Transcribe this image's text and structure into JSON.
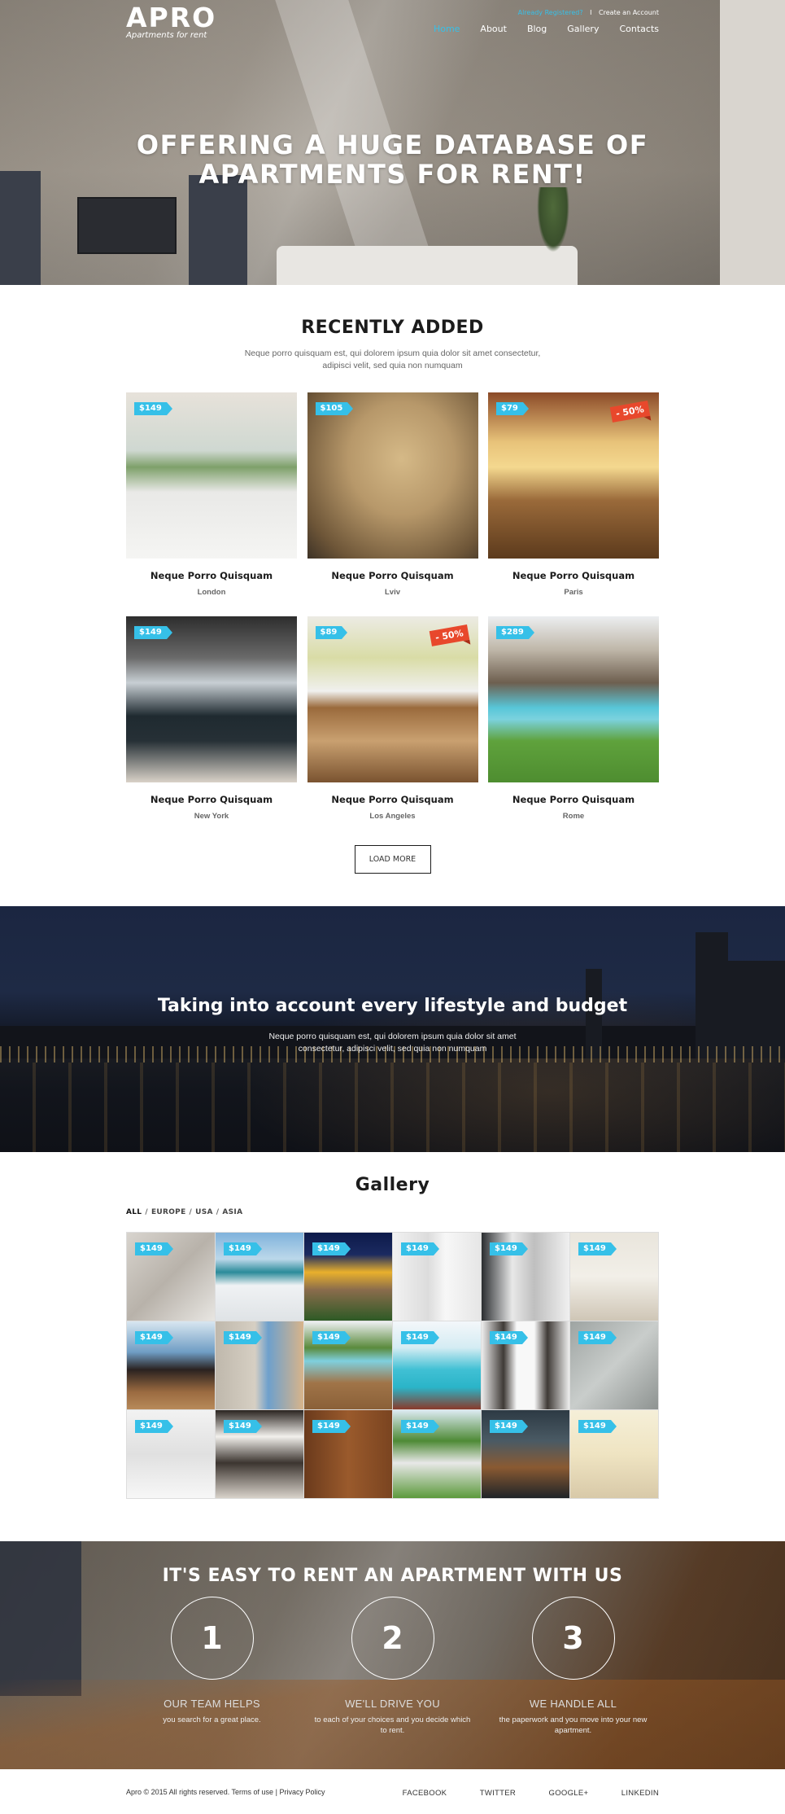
{
  "header": {
    "logo_name": "APRO",
    "logo_tagline": "Apartments for rent",
    "already_registered": "Already Registered?",
    "separator": "I",
    "create_account": "Create an Account",
    "nav": [
      {
        "label": "Home",
        "active": true
      },
      {
        "label": "About",
        "active": false
      },
      {
        "label": "Blog",
        "active": false
      },
      {
        "label": "Gallery",
        "active": false
      },
      {
        "label": "Contacts",
        "active": false
      }
    ]
  },
  "hero": {
    "title_line1": "OFFERING A HUGE DATABASE OF",
    "title_line2": "APARTMENTS FOR RENT!"
  },
  "recent": {
    "title": "RECENTLY ADDED",
    "subtitle": "Neque porro quisquam est, qui dolorem ipsum quia dolor sit amet consectetur, adipisci velit, sed quia non numquam",
    "listings": [
      {
        "price": "$149",
        "title": "Neque Porro Quisquam",
        "city": "London",
        "discount": null
      },
      {
        "price": "$105",
        "title": "Neque Porro Quisquam",
        "city": "Lviv",
        "discount": null
      },
      {
        "price": "$79",
        "title": "Neque Porro Quisquam",
        "city": "Paris",
        "discount": "- 50%"
      },
      {
        "price": "$149",
        "title": "Neque Porro Quisquam",
        "city": "New York",
        "discount": null
      },
      {
        "price": "$89",
        "title": "Neque Porro Quisquam",
        "city": "Los Angeles",
        "discount": "- 50%"
      },
      {
        "price": "$289",
        "title": "Neque Porro Quisquam",
        "city": "Rome",
        "discount": null
      }
    ],
    "load_more": "LOAD MORE"
  },
  "banner": {
    "title": "Taking into account every lifestyle and budget",
    "subtitle": "Neque porro quisquam est, qui dolorem ipsum quia dolor sit amet consectetur, adipisci velit, sed quia non numquam"
  },
  "gallery": {
    "title": "Gallery",
    "filters": [
      {
        "label": "ALL",
        "active": true
      },
      {
        "label": "EUROPE",
        "active": false
      },
      {
        "label": "USA",
        "active": false
      },
      {
        "label": "ASIA",
        "active": false
      }
    ],
    "filter_separator": "/",
    "items": [
      {
        "price": "$149"
      },
      {
        "price": "$149"
      },
      {
        "price": "$149"
      },
      {
        "price": "$149"
      },
      {
        "price": "$149"
      },
      {
        "price": "$149"
      },
      {
        "price": "$149"
      },
      {
        "price": "$149"
      },
      {
        "price": "$149"
      },
      {
        "price": "$149"
      },
      {
        "price": "$149"
      },
      {
        "price": "$149"
      },
      {
        "price": "$149"
      },
      {
        "price": "$149"
      },
      {
        "price": "$149"
      },
      {
        "price": "$149"
      },
      {
        "price": "$149"
      },
      {
        "price": "$149"
      }
    ]
  },
  "steps": {
    "title": "IT'S EASY TO RENT AN APARTMENT WITH US",
    "items": [
      {
        "number": "1",
        "title": "OUR TEAM HELPS",
        "description": "you search for a great place."
      },
      {
        "number": "2",
        "title": "WE'LL DRIVE YOU",
        "description": "to each of your choices and you decide which to rent."
      },
      {
        "number": "3",
        "title": "WE HANDLE ALL",
        "description": "the paperwork and you move into your new apartment."
      }
    ]
  },
  "footer": {
    "copyright": "Apro © 2015 All rights reserved.",
    "terms": "Terms of use",
    "separator": "|",
    "privacy": "Privacy Policy",
    "social": [
      "FACEBOOK",
      "TWITTER",
      "GOOGLE+",
      "LINKEDIN"
    ]
  },
  "colors": {
    "accent": "#36c0e8",
    "sale": "#e8482c",
    "text_dark": "#1c1c1c"
  }
}
